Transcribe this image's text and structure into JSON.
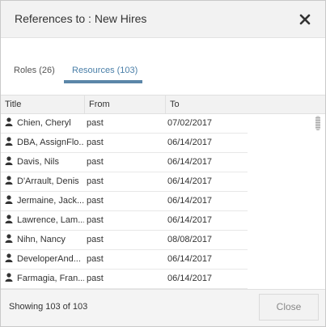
{
  "dialog": {
    "title": "References to : New Hires",
    "close_icon": "close-icon"
  },
  "tabs": [
    {
      "label": "Roles (26)",
      "active": false
    },
    {
      "label": "Resources (103)",
      "active": true
    }
  ],
  "table": {
    "columns": [
      "Title",
      "From",
      "To"
    ],
    "rows": [
      {
        "title": "Chien, Cheryl",
        "from": "past",
        "to": "07/02/2017"
      },
      {
        "title": "DBA, AssignFlo...",
        "from": "past",
        "to": "06/14/2017"
      },
      {
        "title": "Davis, Nils",
        "from": "past",
        "to": "06/14/2017"
      },
      {
        "title": "D'Arrault, Denis",
        "from": "past",
        "to": "06/14/2017"
      },
      {
        "title": "Jermaine, Jack...",
        "from": "past",
        "to": "06/14/2017"
      },
      {
        "title": "Lawrence, Lam...",
        "from": "past",
        "to": "06/14/2017"
      },
      {
        "title": "Nihn, Nancy",
        "from": "past",
        "to": "08/08/2017"
      },
      {
        "title": "DeveloperAnd...",
        "from": "past",
        "to": "06/14/2017"
      },
      {
        "title": "Farmagia, Fran...",
        "from": "past",
        "to": "06/14/2017"
      }
    ],
    "row_icon": "person-icon"
  },
  "footer": {
    "showing": "Showing 103 of 103",
    "close_label": "Close"
  },
  "colors": {
    "accent": "#5b86a8",
    "active_tab_text": "#4a7fa8",
    "header_bg": "#f2f2f2"
  }
}
